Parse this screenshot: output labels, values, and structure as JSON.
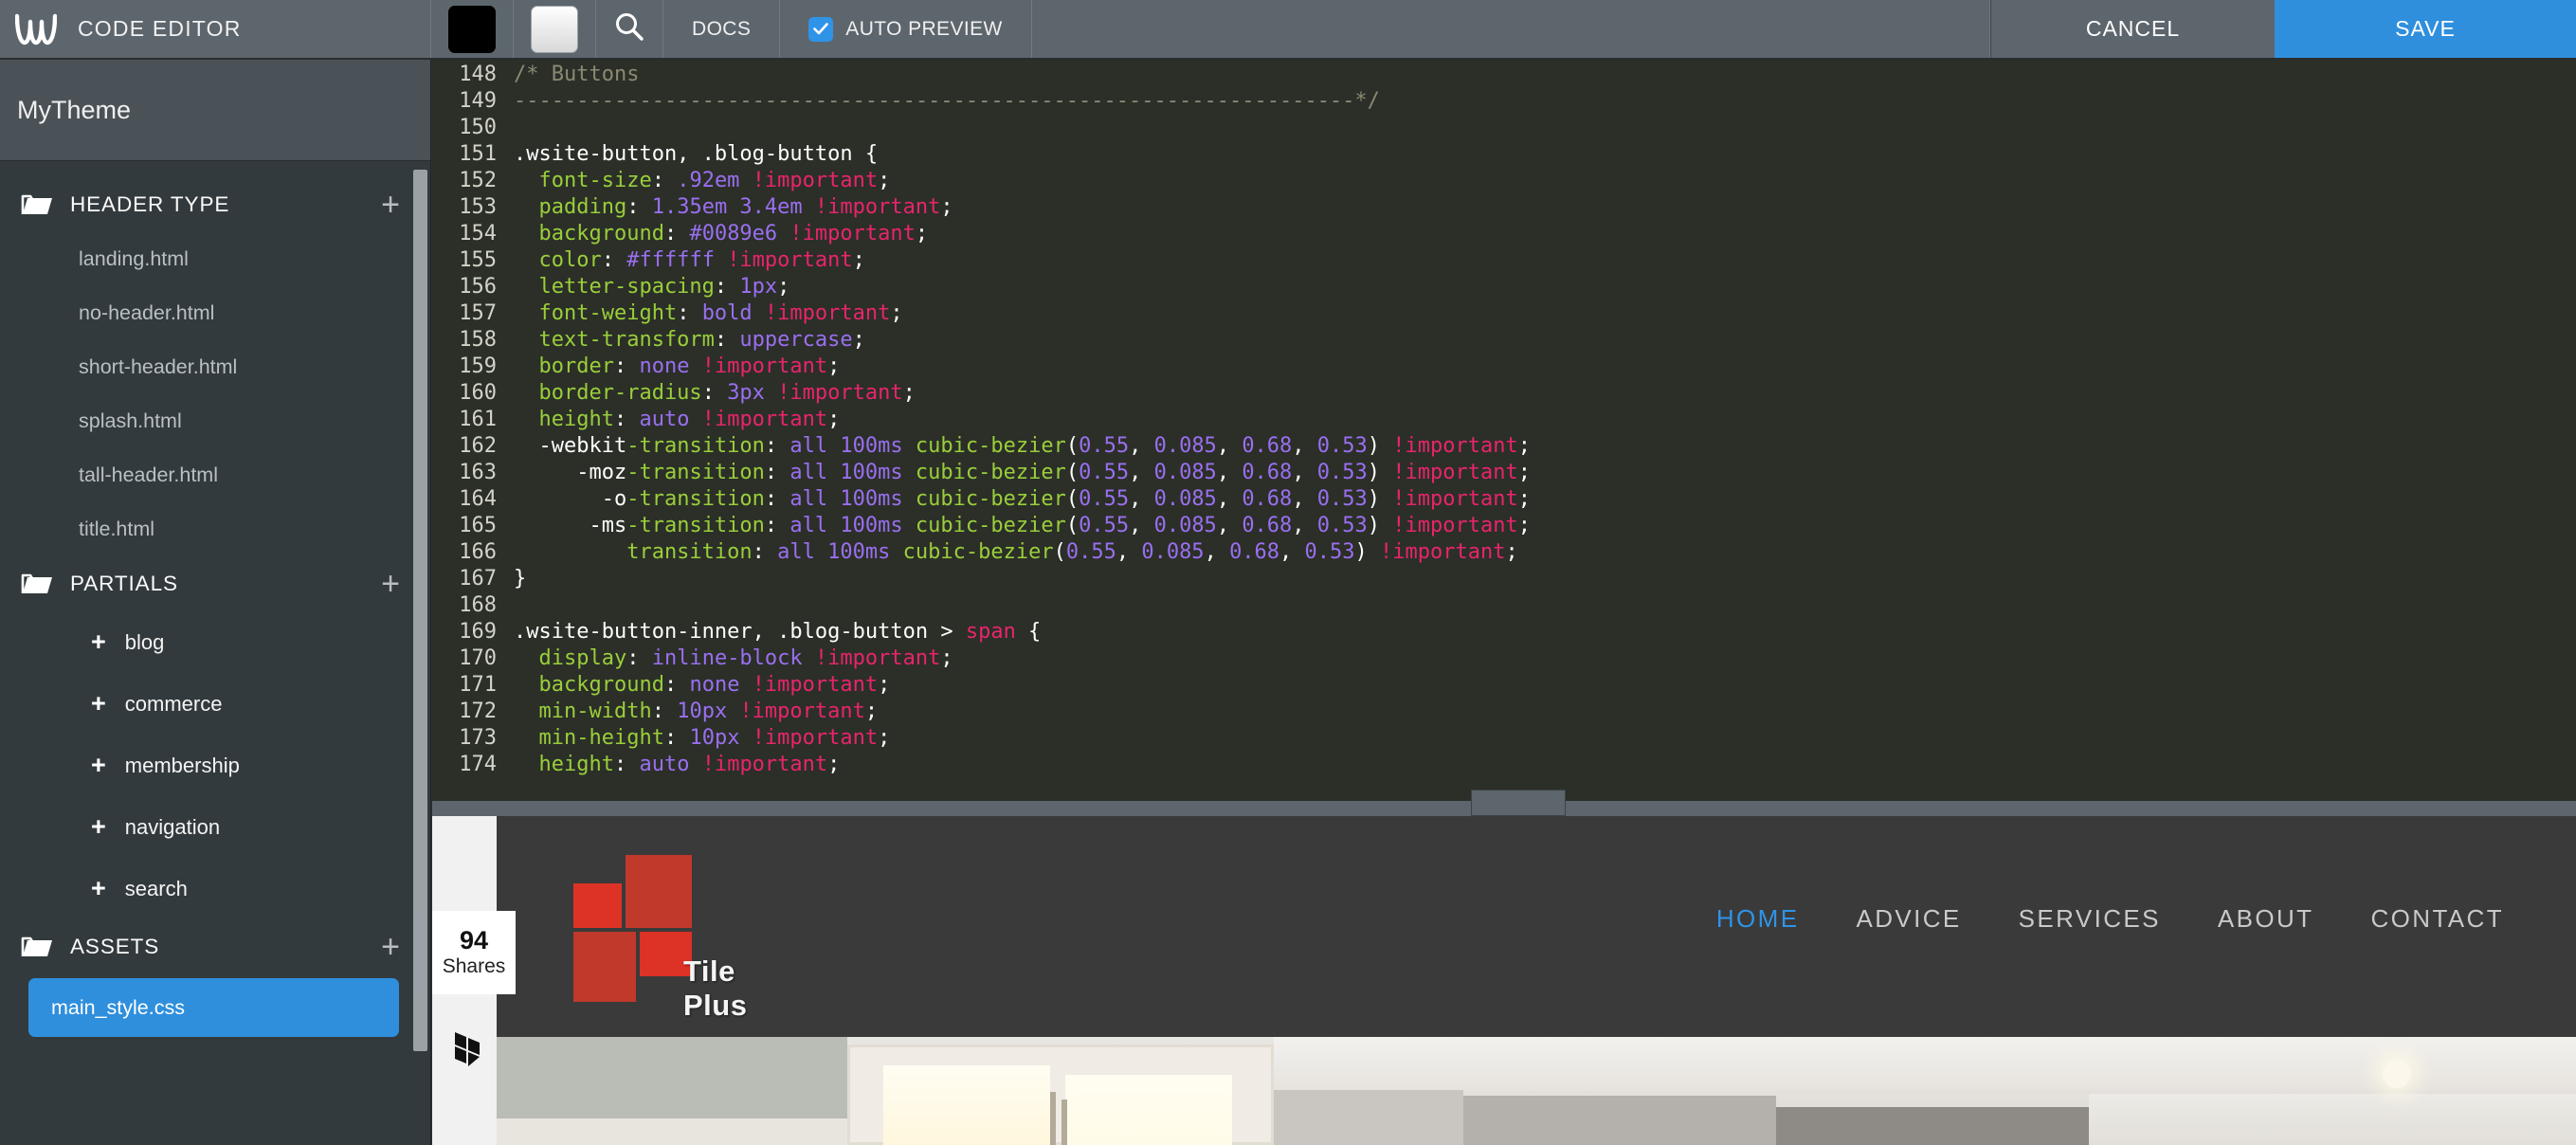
{
  "topbar": {
    "logo_icon": "weebly-w-logo-icon",
    "title": "CODE EDITOR",
    "swatch_dark_name": "dark-theme-swatch",
    "swatch_light_name": "light-theme-swatch",
    "search_icon": "search-icon",
    "docs_label": "DOCS",
    "auto_preview_label": "AUTO PREVIEW",
    "auto_preview_checked": true,
    "cancel_label": "CANCEL",
    "save_label": "SAVE",
    "accent_blue": "#2f8fdd",
    "bar_bg": "#5d666d"
  },
  "sidebar": {
    "theme_name": "MyTheme",
    "groups": [
      {
        "label": "HEADER TYPE",
        "icon": "folder-icon",
        "add_icon": "plus-icon",
        "files": [
          "landing.html",
          "no-header.html",
          "short-header.html",
          "splash.html",
          "tall-header.html",
          "title.html"
        ]
      },
      {
        "label": "PARTIALS",
        "icon": "folder-icon",
        "add_icon": "plus-icon",
        "partials": [
          "blog",
          "commerce",
          "membership",
          "navigation",
          "search"
        ]
      },
      {
        "label": "ASSETS",
        "icon": "folder-icon",
        "add_icon": "plus-icon",
        "selected_file": "main_style.css"
      }
    ]
  },
  "editor": {
    "first_visible_line": 148,
    "lines": [
      {
        "n": "148",
        "tokens": [
          {
            "t": "/* Buttons",
            "c": "com"
          }
        ]
      },
      {
        "n": "149",
        "tokens": [
          {
            "t": "-------------------------------------------------------------------*/",
            "c": "com"
          }
        ]
      },
      {
        "n": "150",
        "tokens": [
          {
            "t": "",
            "c": "sel"
          }
        ]
      },
      {
        "n": "151",
        "tokens": [
          {
            "t": ".wsite-button, .blog-button {",
            "c": "sel"
          }
        ]
      },
      {
        "n": "152",
        "tokens": [
          {
            "t": "  font-size",
            "c": "prop"
          },
          {
            "t": ": ",
            "c": "punc"
          },
          {
            "t": ".92em",
            "c": "val"
          },
          {
            "t": " ",
            "c": "punc"
          },
          {
            "t": "!important",
            "c": "imp"
          },
          {
            "t": ";",
            "c": "punc"
          }
        ]
      },
      {
        "n": "153",
        "tokens": [
          {
            "t": "  padding",
            "c": "prop"
          },
          {
            "t": ": ",
            "c": "punc"
          },
          {
            "t": "1.35em 3.4em",
            "c": "val"
          },
          {
            "t": " ",
            "c": "punc"
          },
          {
            "t": "!important",
            "c": "imp"
          },
          {
            "t": ";",
            "c": "punc"
          }
        ]
      },
      {
        "n": "154",
        "tokens": [
          {
            "t": "  background",
            "c": "prop"
          },
          {
            "t": ": ",
            "c": "punc"
          },
          {
            "t": "#0089e6",
            "c": "val"
          },
          {
            "t": " ",
            "c": "punc"
          },
          {
            "t": "!important",
            "c": "imp"
          },
          {
            "t": ";",
            "c": "punc"
          }
        ]
      },
      {
        "n": "155",
        "tokens": [
          {
            "t": "  color",
            "c": "prop"
          },
          {
            "t": ": ",
            "c": "punc"
          },
          {
            "t": "#ffffff",
            "c": "val"
          },
          {
            "t": " ",
            "c": "punc"
          },
          {
            "t": "!important",
            "c": "imp"
          },
          {
            "t": ";",
            "c": "punc"
          }
        ]
      },
      {
        "n": "156",
        "tokens": [
          {
            "t": "  letter-spacing",
            "c": "prop"
          },
          {
            "t": ": ",
            "c": "punc"
          },
          {
            "t": "1px",
            "c": "val"
          },
          {
            "t": ";",
            "c": "punc"
          }
        ]
      },
      {
        "n": "157",
        "tokens": [
          {
            "t": "  font-weight",
            "c": "prop"
          },
          {
            "t": ": ",
            "c": "punc"
          },
          {
            "t": "bold",
            "c": "val"
          },
          {
            "t": " ",
            "c": "punc"
          },
          {
            "t": "!important",
            "c": "imp"
          },
          {
            "t": ";",
            "c": "punc"
          }
        ]
      },
      {
        "n": "158",
        "tokens": [
          {
            "t": "  text-transform",
            "c": "prop"
          },
          {
            "t": ": ",
            "c": "punc"
          },
          {
            "t": "uppercase",
            "c": "val"
          },
          {
            "t": ";",
            "c": "punc"
          }
        ]
      },
      {
        "n": "159",
        "tokens": [
          {
            "t": "  border",
            "c": "prop"
          },
          {
            "t": ": ",
            "c": "punc"
          },
          {
            "t": "none",
            "c": "val"
          },
          {
            "t": " ",
            "c": "punc"
          },
          {
            "t": "!important",
            "c": "imp"
          },
          {
            "t": ";",
            "c": "punc"
          }
        ]
      },
      {
        "n": "160",
        "tokens": [
          {
            "t": "  border-radius",
            "c": "prop"
          },
          {
            "t": ": ",
            "c": "punc"
          },
          {
            "t": "3px",
            "c": "val"
          },
          {
            "t": " ",
            "c": "punc"
          },
          {
            "t": "!important",
            "c": "imp"
          },
          {
            "t": ";",
            "c": "punc"
          }
        ]
      },
      {
        "n": "161",
        "tokens": [
          {
            "t": "  height",
            "c": "prop"
          },
          {
            "t": ": ",
            "c": "punc"
          },
          {
            "t": "auto",
            "c": "val"
          },
          {
            "t": " ",
            "c": "punc"
          },
          {
            "t": "!important",
            "c": "imp"
          },
          {
            "t": ";",
            "c": "punc"
          }
        ]
      },
      {
        "n": "162",
        "tokens": [
          {
            "t": "  -webkit",
            "c": "sel"
          },
          {
            "t": "-transition",
            "c": "prop"
          },
          {
            "t": ": ",
            "c": "punc"
          },
          {
            "t": "all 100ms",
            "c": "val"
          },
          {
            "t": " ",
            "c": "punc"
          },
          {
            "t": "cubic-bezier",
            "c": "fn"
          },
          {
            "t": "(",
            "c": "punc"
          },
          {
            "t": "0.55",
            "c": "val"
          },
          {
            "t": ", ",
            "c": "punc"
          },
          {
            "t": "0.085",
            "c": "val"
          },
          {
            "t": ", ",
            "c": "punc"
          },
          {
            "t": "0.68",
            "c": "val"
          },
          {
            "t": ", ",
            "c": "punc"
          },
          {
            "t": "0.53",
            "c": "val"
          },
          {
            "t": ") ",
            "c": "punc"
          },
          {
            "t": "!important",
            "c": "imp"
          },
          {
            "t": ";",
            "c": "punc"
          }
        ]
      },
      {
        "n": "163",
        "tokens": [
          {
            "t": "     -moz",
            "c": "sel"
          },
          {
            "t": "-transition",
            "c": "prop"
          },
          {
            "t": ": ",
            "c": "punc"
          },
          {
            "t": "all 100ms",
            "c": "val"
          },
          {
            "t": " ",
            "c": "punc"
          },
          {
            "t": "cubic-bezier",
            "c": "fn"
          },
          {
            "t": "(",
            "c": "punc"
          },
          {
            "t": "0.55",
            "c": "val"
          },
          {
            "t": ", ",
            "c": "punc"
          },
          {
            "t": "0.085",
            "c": "val"
          },
          {
            "t": ", ",
            "c": "punc"
          },
          {
            "t": "0.68",
            "c": "val"
          },
          {
            "t": ", ",
            "c": "punc"
          },
          {
            "t": "0.53",
            "c": "val"
          },
          {
            "t": ") ",
            "c": "punc"
          },
          {
            "t": "!important",
            "c": "imp"
          },
          {
            "t": ";",
            "c": "punc"
          }
        ]
      },
      {
        "n": "164",
        "tokens": [
          {
            "t": "       -o",
            "c": "sel"
          },
          {
            "t": "-transition",
            "c": "prop"
          },
          {
            "t": ": ",
            "c": "punc"
          },
          {
            "t": "all 100ms",
            "c": "val"
          },
          {
            "t": " ",
            "c": "punc"
          },
          {
            "t": "cubic-bezier",
            "c": "fn"
          },
          {
            "t": "(",
            "c": "punc"
          },
          {
            "t": "0.55",
            "c": "val"
          },
          {
            "t": ", ",
            "c": "punc"
          },
          {
            "t": "0.085",
            "c": "val"
          },
          {
            "t": ", ",
            "c": "punc"
          },
          {
            "t": "0.68",
            "c": "val"
          },
          {
            "t": ", ",
            "c": "punc"
          },
          {
            "t": "0.53",
            "c": "val"
          },
          {
            "t": ") ",
            "c": "punc"
          },
          {
            "t": "!important",
            "c": "imp"
          },
          {
            "t": ";",
            "c": "punc"
          }
        ]
      },
      {
        "n": "165",
        "tokens": [
          {
            "t": "      -ms",
            "c": "sel"
          },
          {
            "t": "-transition",
            "c": "prop"
          },
          {
            "t": ": ",
            "c": "punc"
          },
          {
            "t": "all 100ms",
            "c": "val"
          },
          {
            "t": " ",
            "c": "punc"
          },
          {
            "t": "cubic-bezier",
            "c": "fn"
          },
          {
            "t": "(",
            "c": "punc"
          },
          {
            "t": "0.55",
            "c": "val"
          },
          {
            "t": ", ",
            "c": "punc"
          },
          {
            "t": "0.085",
            "c": "val"
          },
          {
            "t": ", ",
            "c": "punc"
          },
          {
            "t": "0.68",
            "c": "val"
          },
          {
            "t": ", ",
            "c": "punc"
          },
          {
            "t": "0.53",
            "c": "val"
          },
          {
            "t": ") ",
            "c": "punc"
          },
          {
            "t": "!important",
            "c": "imp"
          },
          {
            "t": ";",
            "c": "punc"
          }
        ]
      },
      {
        "n": "166",
        "tokens": [
          {
            "t": "         transition",
            "c": "prop"
          },
          {
            "t": ": ",
            "c": "punc"
          },
          {
            "t": "all 100ms",
            "c": "val"
          },
          {
            "t": " ",
            "c": "punc"
          },
          {
            "t": "cubic-bezier",
            "c": "fn"
          },
          {
            "t": "(",
            "c": "punc"
          },
          {
            "t": "0.55",
            "c": "val"
          },
          {
            "t": ", ",
            "c": "punc"
          },
          {
            "t": "0.085",
            "c": "val"
          },
          {
            "t": ", ",
            "c": "punc"
          },
          {
            "t": "0.68",
            "c": "val"
          },
          {
            "t": ", ",
            "c": "punc"
          },
          {
            "t": "0.53",
            "c": "val"
          },
          {
            "t": ") ",
            "c": "punc"
          },
          {
            "t": "!important",
            "c": "imp"
          },
          {
            "t": ";",
            "c": "punc"
          }
        ]
      },
      {
        "n": "167",
        "tokens": [
          {
            "t": "}",
            "c": "sel"
          }
        ]
      },
      {
        "n": "168",
        "tokens": [
          {
            "t": "",
            "c": "sel"
          }
        ]
      },
      {
        "n": "169",
        "tokens": [
          {
            "t": ".wsite-button-inner, .blog-button > ",
            "c": "sel"
          },
          {
            "t": "span",
            "c": "tag"
          },
          {
            "t": " {",
            "c": "sel"
          }
        ]
      },
      {
        "n": "170",
        "tokens": [
          {
            "t": "  display",
            "c": "prop"
          },
          {
            "t": ": ",
            "c": "punc"
          },
          {
            "t": "inline-block",
            "c": "val"
          },
          {
            "t": " ",
            "c": "punc"
          },
          {
            "t": "!important",
            "c": "imp"
          },
          {
            "t": ";",
            "c": "punc"
          }
        ]
      },
      {
        "n": "171",
        "tokens": [
          {
            "t": "  background",
            "c": "prop"
          },
          {
            "t": ": ",
            "c": "punc"
          },
          {
            "t": "none",
            "c": "val"
          },
          {
            "t": " ",
            "c": "punc"
          },
          {
            "t": "!important",
            "c": "imp"
          },
          {
            "t": ";",
            "c": "punc"
          }
        ]
      },
      {
        "n": "172",
        "tokens": [
          {
            "t": "  min-width",
            "c": "prop"
          },
          {
            "t": ": ",
            "c": "punc"
          },
          {
            "t": "10px",
            "c": "val"
          },
          {
            "t": " ",
            "c": "punc"
          },
          {
            "t": "!important",
            "c": "imp"
          },
          {
            "t": ";",
            "c": "punc"
          }
        ]
      },
      {
        "n": "173",
        "tokens": [
          {
            "t": "  min-height",
            "c": "prop"
          },
          {
            "t": ": ",
            "c": "punc"
          },
          {
            "t": "10px",
            "c": "val"
          },
          {
            "t": " ",
            "c": "punc"
          },
          {
            "t": "!important",
            "c": "imp"
          },
          {
            "t": ";",
            "c": "punc"
          }
        ]
      },
      {
        "n": "174",
        "tokens": [
          {
            "t": "  height",
            "c": "prop"
          },
          {
            "t": ": ",
            "c": "punc"
          },
          {
            "t": "auto",
            "c": "val"
          },
          {
            "t": " ",
            "c": "punc"
          },
          {
            "t": "!important",
            "c": "imp"
          },
          {
            "t": ";",
            "c": "punc"
          }
        ]
      }
    ]
  },
  "preview": {
    "logo_text": "Tile Plus",
    "logo_color": "#c0392b",
    "nav": [
      {
        "label": "HOME",
        "active": true
      },
      {
        "label": "ADVICE",
        "active": false
      },
      {
        "label": "SERVICES",
        "active": false
      },
      {
        "label": "ABOUT",
        "active": false
      },
      {
        "label": "CONTACT",
        "active": false
      }
    ],
    "share": {
      "count": "94",
      "label": "Shares",
      "icon": "houzz-icon"
    },
    "photo_alt": "kitchen-cabinets-photo"
  }
}
